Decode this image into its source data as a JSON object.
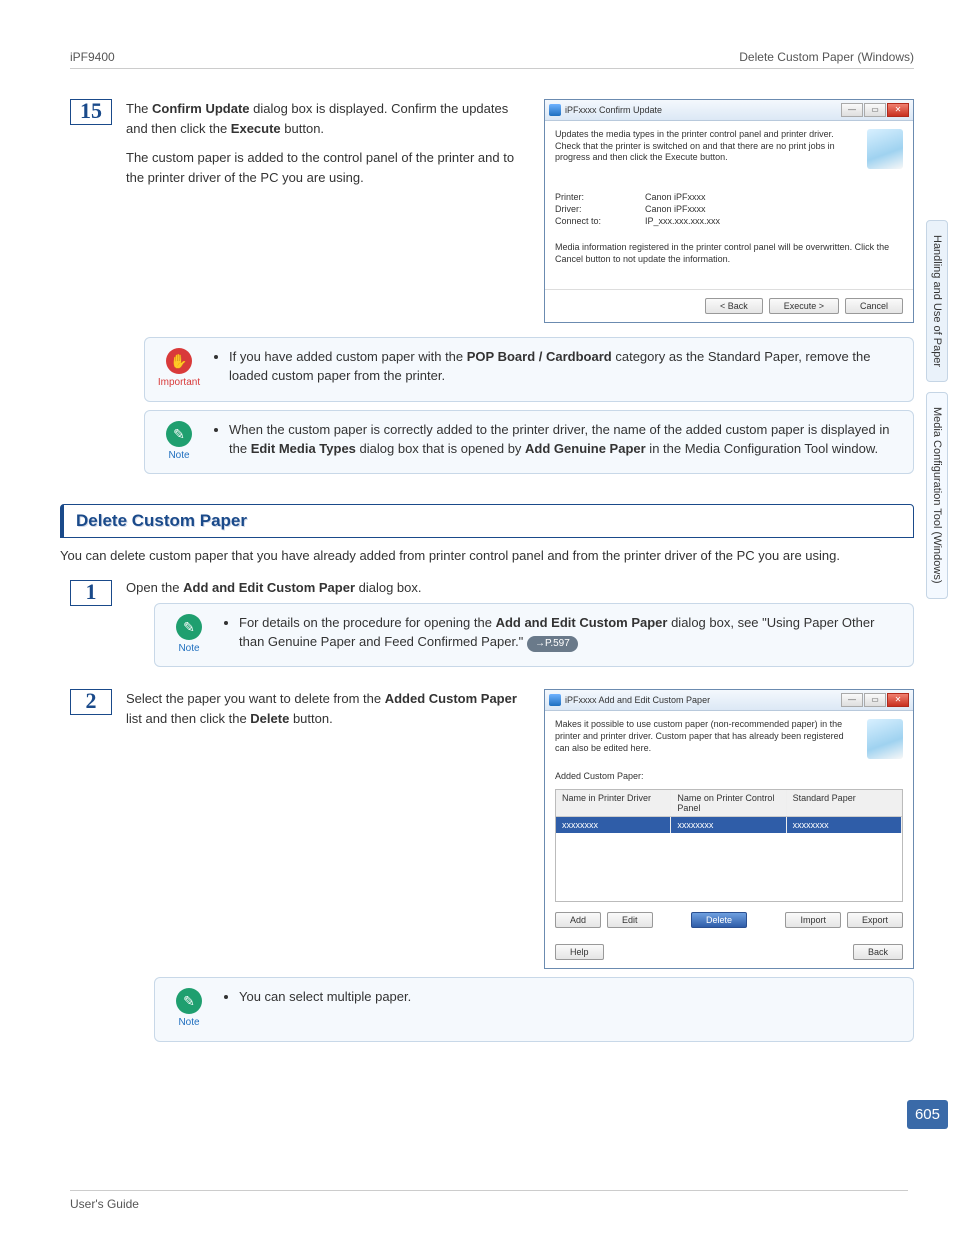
{
  "header": {
    "left": "iPF9400",
    "right": "Delete Custom Paper (Windows)"
  },
  "sidebar_tabs": {
    "a": "Handling and Use of Paper",
    "b": "Media Configuration Tool (Windows)"
  },
  "step15": {
    "num": "15",
    "p1_pre": "The ",
    "p1_b1": "Confirm Update",
    "p1_mid": " dialog box is displayed. Confirm the updates and then click the ",
    "p1_b2": "Execute",
    "p1_post": " button.",
    "p2": "The custom paper is added to the control panel of the printer and to the printer driver of the PC you are using."
  },
  "dlg1": {
    "title": "iPFxxxx Confirm Update",
    "desc": "Updates the media types in the printer control panel and printer driver. Check that the printer is switched on and that there are no print jobs in progress and then click the Execute button.",
    "printer_k": "Printer:",
    "printer_v": "Canon iPFxxxx",
    "driver_k": "Driver:",
    "driver_v": "Canon iPFxxxx",
    "connect_k": "Connect to:",
    "connect_v": "IP_xxx.xxx.xxx.xxx",
    "note": "Media information registered in the printer control panel will be overwritten. Click the Cancel button to not update the information.",
    "back": "< Back",
    "execute": "Execute >",
    "cancel": "Cancel"
  },
  "important": {
    "label": "Important",
    "text_pre": "If you have added custom paper with the ",
    "text_b": "POP Board / Cardboard",
    "text_post": " category as the Standard Paper, remove the loaded custom paper from the printer."
  },
  "note1": {
    "label": "Note",
    "text_pre": "When the custom paper is correctly added to the printer driver, the name of the added custom paper is displayed in the ",
    "text_b1": "Edit Media Types",
    "text_mid": " dialog box that is opened by ",
    "text_b2": "Add Genuine Paper",
    "text_post": " in the Media Configuration Tool window."
  },
  "section": {
    "title": "Delete Custom Paper",
    "intro": "You can delete custom paper that you have already added from printer control panel and from the printer driver of the PC you are using."
  },
  "step1": {
    "num": "1",
    "pre": "Open the ",
    "b": "Add and Edit Custom Paper",
    "post": " dialog box."
  },
  "note2": {
    "label": "Note",
    "text_pre": "For details on the procedure for opening the ",
    "text_b": "Add and Edit Custom Paper",
    "text_post": " dialog box, see \"Using Paper Other than Genuine Paper and Feed Confirmed Paper.\"",
    "link": "→P.597"
  },
  "step2": {
    "num": "2",
    "pre": "Select the paper you want to delete from the ",
    "b1": "Added Custom Paper",
    "mid": " list and then click the ",
    "b2": "Delete",
    "post": " button."
  },
  "dlg2": {
    "title": "iPFxxxx Add and Edit Custom Paper",
    "desc": "Makes it possible to use custom paper (non-recommended paper) in the printer and printer driver. Custom paper that has already been registered can also be edited here.",
    "list_label": "Added Custom Paper:",
    "col1": "Name in Printer Driver",
    "col2": "Name on Printer Control Panel",
    "col3": "Standard Paper",
    "row1": "xxxxxxxx",
    "row2": "xxxxxxxx",
    "row3": "xxxxxxxx",
    "add": "Add",
    "edit": "Edit",
    "delete": "Delete",
    "import": "Import",
    "export": "Export",
    "help": "Help",
    "back": "Back"
  },
  "note3": {
    "label": "Note",
    "text": "You can select multiple paper."
  },
  "page_number": "605",
  "footer": "User's Guide"
}
